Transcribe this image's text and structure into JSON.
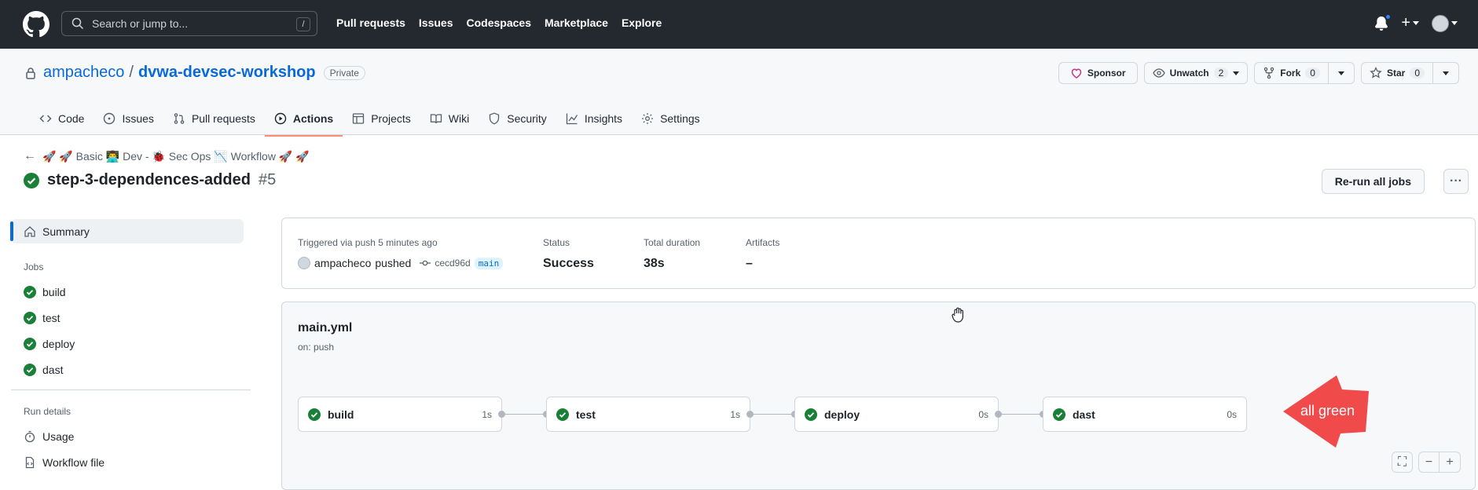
{
  "header": {
    "search_placeholder": "Search or jump to...",
    "search_shortcut": "/",
    "nav": [
      "Pull requests",
      "Issues",
      "Codespaces",
      "Marketplace",
      "Explore"
    ],
    "plus_label": "+"
  },
  "repo": {
    "owner": "ampacheco",
    "separator": "/",
    "name": "dvwa-devsec-workshop",
    "visibility": "Private",
    "sponsor_label": "Sponsor",
    "watch_label": "Unwatch",
    "watch_count": "2",
    "fork_label": "Fork",
    "fork_count": "0",
    "star_label": "Star",
    "star_count": "0",
    "tabs": [
      {
        "label": "Code",
        "icon": "code-icon"
      },
      {
        "label": "Issues",
        "icon": "issue-icon"
      },
      {
        "label": "Pull requests",
        "icon": "pull-request-icon"
      },
      {
        "label": "Actions",
        "icon": "play-icon",
        "active": true
      },
      {
        "label": "Projects",
        "icon": "table-icon"
      },
      {
        "label": "Wiki",
        "icon": "book-icon"
      },
      {
        "label": "Security",
        "icon": "shield-icon"
      },
      {
        "label": "Insights",
        "icon": "graph-icon"
      },
      {
        "label": "Settings",
        "icon": "gear-icon"
      }
    ]
  },
  "run": {
    "back_arrow": "←",
    "workflow_name": "🚀 🚀 Basic 👨‍💻 Dev - 🐞 Sec Ops 📉 Workflow 🚀 🚀",
    "title": "step-3-dependences-added",
    "number": "#5",
    "rerun_label": "Re-run all jobs",
    "more_label": "···",
    "status_color": "#1a7f37"
  },
  "sidebar": {
    "summary_label": "Summary",
    "jobs_heading": "Jobs",
    "jobs": [
      "build",
      "test",
      "deploy",
      "dast"
    ],
    "run_details_heading": "Run details",
    "details": [
      {
        "label": "Usage",
        "icon": "stopwatch-icon"
      },
      {
        "label": "Workflow file",
        "icon": "file-code-icon"
      }
    ]
  },
  "summary": {
    "triggered_label": "Triggered via push 5 minutes ago",
    "actor": "ampacheco",
    "action": "pushed",
    "commit": "cecd96d",
    "branch": "main",
    "status_label": "Status",
    "status_value": "Success",
    "duration_label": "Total duration",
    "duration_value": "38s",
    "artifacts_label": "Artifacts",
    "artifacts_value": "–"
  },
  "graph": {
    "file": "main.yml",
    "trigger": "on: push",
    "jobs": [
      {
        "name": "build",
        "duration": "1s"
      },
      {
        "name": "test",
        "duration": "1s"
      },
      {
        "name": "deploy",
        "duration": "0s"
      },
      {
        "name": "dast",
        "duration": "0s"
      }
    ],
    "fullscreen_icon": "⛶",
    "zoom_out": "−",
    "zoom_in": "+"
  },
  "annotation": {
    "text": "all green",
    "color": "#f04a4a"
  }
}
